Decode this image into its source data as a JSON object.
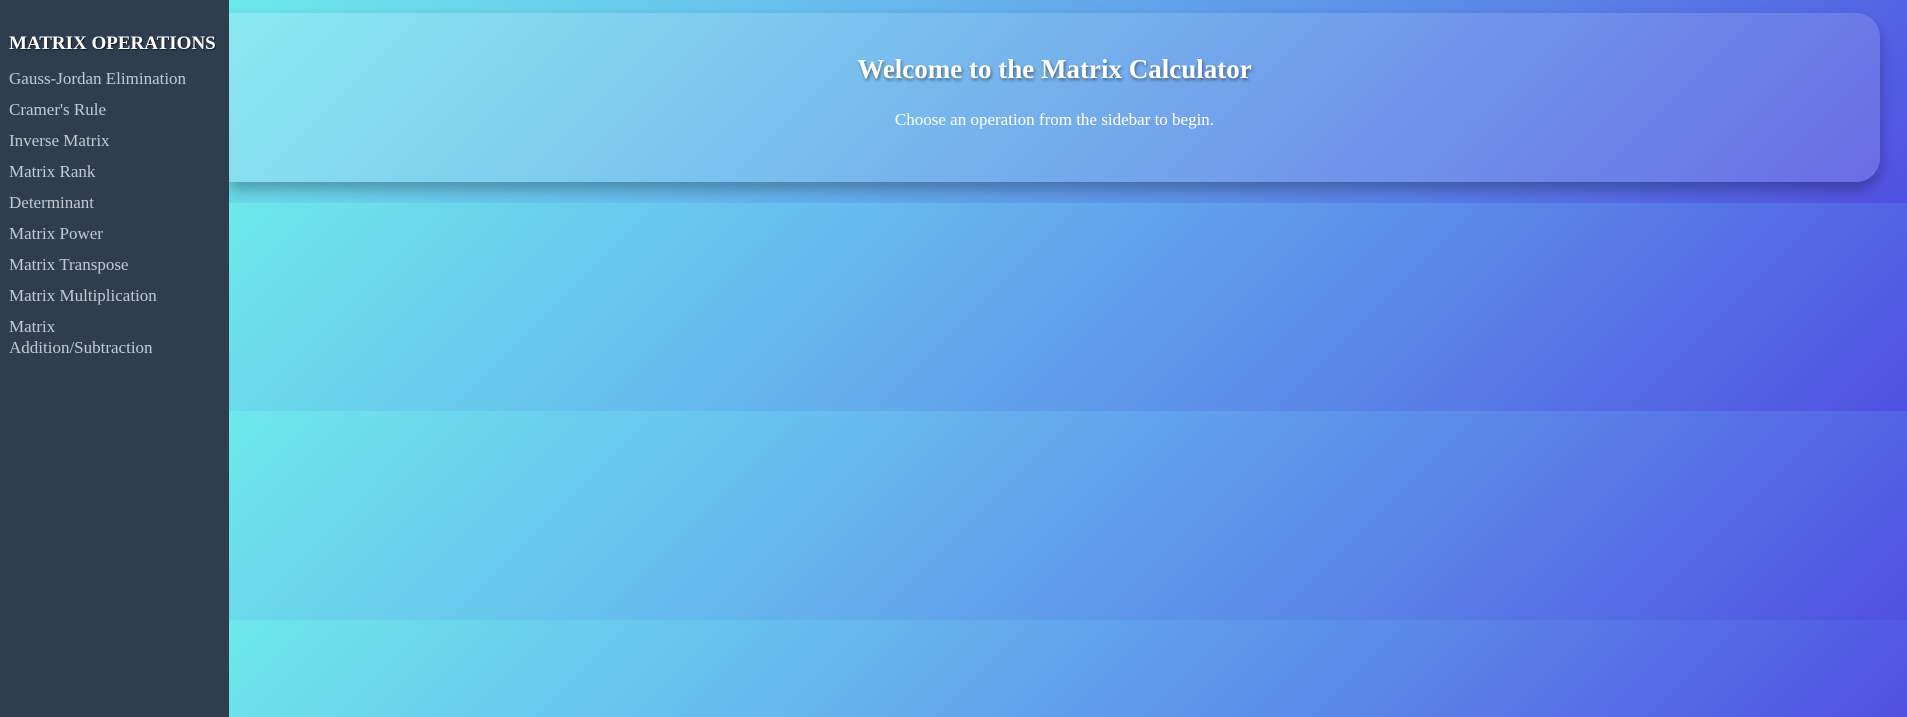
{
  "sidebar": {
    "title": "MATRIX OPERATIONS",
    "items": [
      {
        "label": "Gauss-Jordan Elimination"
      },
      {
        "label": "Cramer's Rule"
      },
      {
        "label": "Inverse Matrix"
      },
      {
        "label": "Matrix Rank"
      },
      {
        "label": "Determinant"
      },
      {
        "label": "Matrix Power"
      },
      {
        "label": "Matrix Transpose"
      },
      {
        "label": "Matrix Multiplication"
      },
      {
        "label": "Matrix Addition/Subtraction"
      }
    ]
  },
  "main": {
    "title": "Welcome to the Matrix Calculator",
    "subtitle": "Choose an operation from the sidebar to begin."
  },
  "colors": {
    "sidebar_bg": "#2e3e4f",
    "nav_text": "#c3cad2",
    "gradient_start": "#6de8eb",
    "gradient_end": "#5050e2"
  }
}
